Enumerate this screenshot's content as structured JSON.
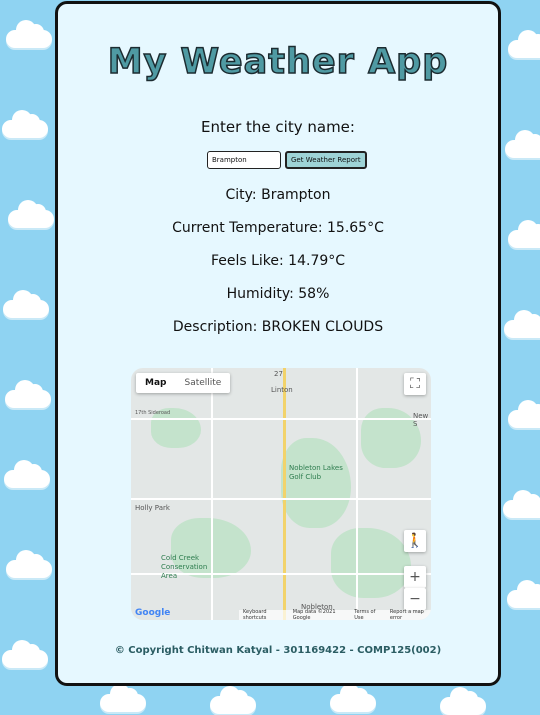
{
  "app": {
    "title": "My Weather App",
    "city_prompt": "Enter the city name:",
    "city_value": "Brampton",
    "button_label": "Get Weather Report"
  },
  "weather": {
    "city": "City: Brampton",
    "temperature": "Current Temperature: 15.65°C",
    "feels_like": "Feels Like: 14.79°C",
    "humidity": "Humidity: 58%",
    "description": "Description: BROKEN CLOUDS"
  },
  "map": {
    "tab_map": "Map",
    "tab_satellite": "Satellite",
    "labels": {
      "linton": "Linton",
      "new_s": "New S",
      "nobleton_lakes": "Nobleton Lakes Golf Club",
      "holly_park": "Holly Park",
      "cold_creek": "Cold Creek Conservation Area",
      "nobleton": "Nobleton",
      "route_27": "27",
      "side_road_17": "17th Sideroad"
    },
    "zoom_in": "+",
    "zoom_out": "−",
    "google": "Google",
    "attribution": {
      "shortcuts": "Keyboard shortcuts",
      "mapdata": "Map data ©2021 Google",
      "terms": "Terms of Use",
      "report": "Report a map error"
    }
  },
  "footer": {
    "text": "© Copyright Chitwan Katyal - 301169422 - COMP125(002)"
  },
  "colors": {
    "background": "#8fd3f2",
    "card": "#e6f8ff",
    "title_fill": "#4f9aa3",
    "button": "#9ed3d6",
    "footer_text": "#2b5d63"
  }
}
